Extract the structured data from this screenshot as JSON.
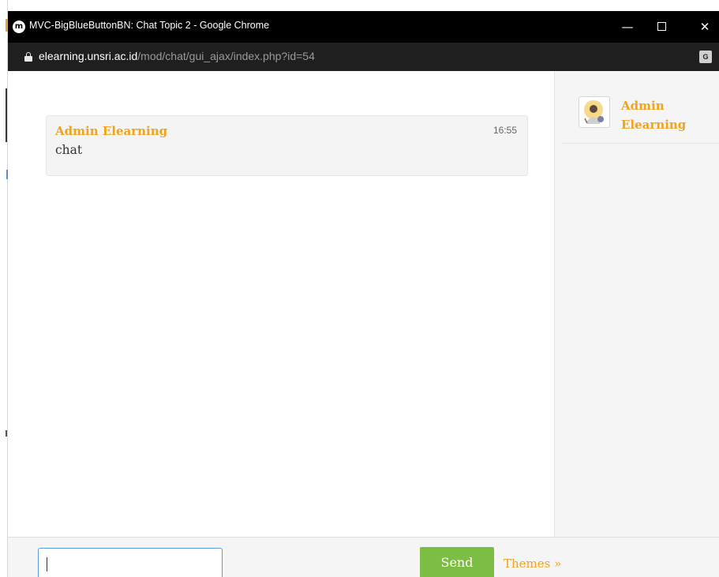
{
  "window": {
    "title": "MVC-BigBlueButtonBN: Chat Topic 2 - Google Chrome",
    "app_icon": "m",
    "controls": {
      "minimize": "—",
      "close": "✕"
    }
  },
  "address": {
    "domain": "elearning.unsri.ac.id",
    "path": "/mod/chat/gui_ajax/index.php?id=54",
    "translate_icon": "G"
  },
  "messages": [
    {
      "author": "Admin Elearning",
      "time": "16:55",
      "text": "chat"
    }
  ],
  "users": [
    {
      "name": "Admin Elearning"
    }
  ],
  "composer": {
    "value": "",
    "send_label": "Send",
    "themes_label": "Themes »"
  },
  "colors": {
    "accent": "#f2a21b",
    "send_button": "#7cbd43",
    "titlebar": "#000000",
    "addressbar": "#1f1f1f",
    "input_border": "#5a9be0"
  }
}
